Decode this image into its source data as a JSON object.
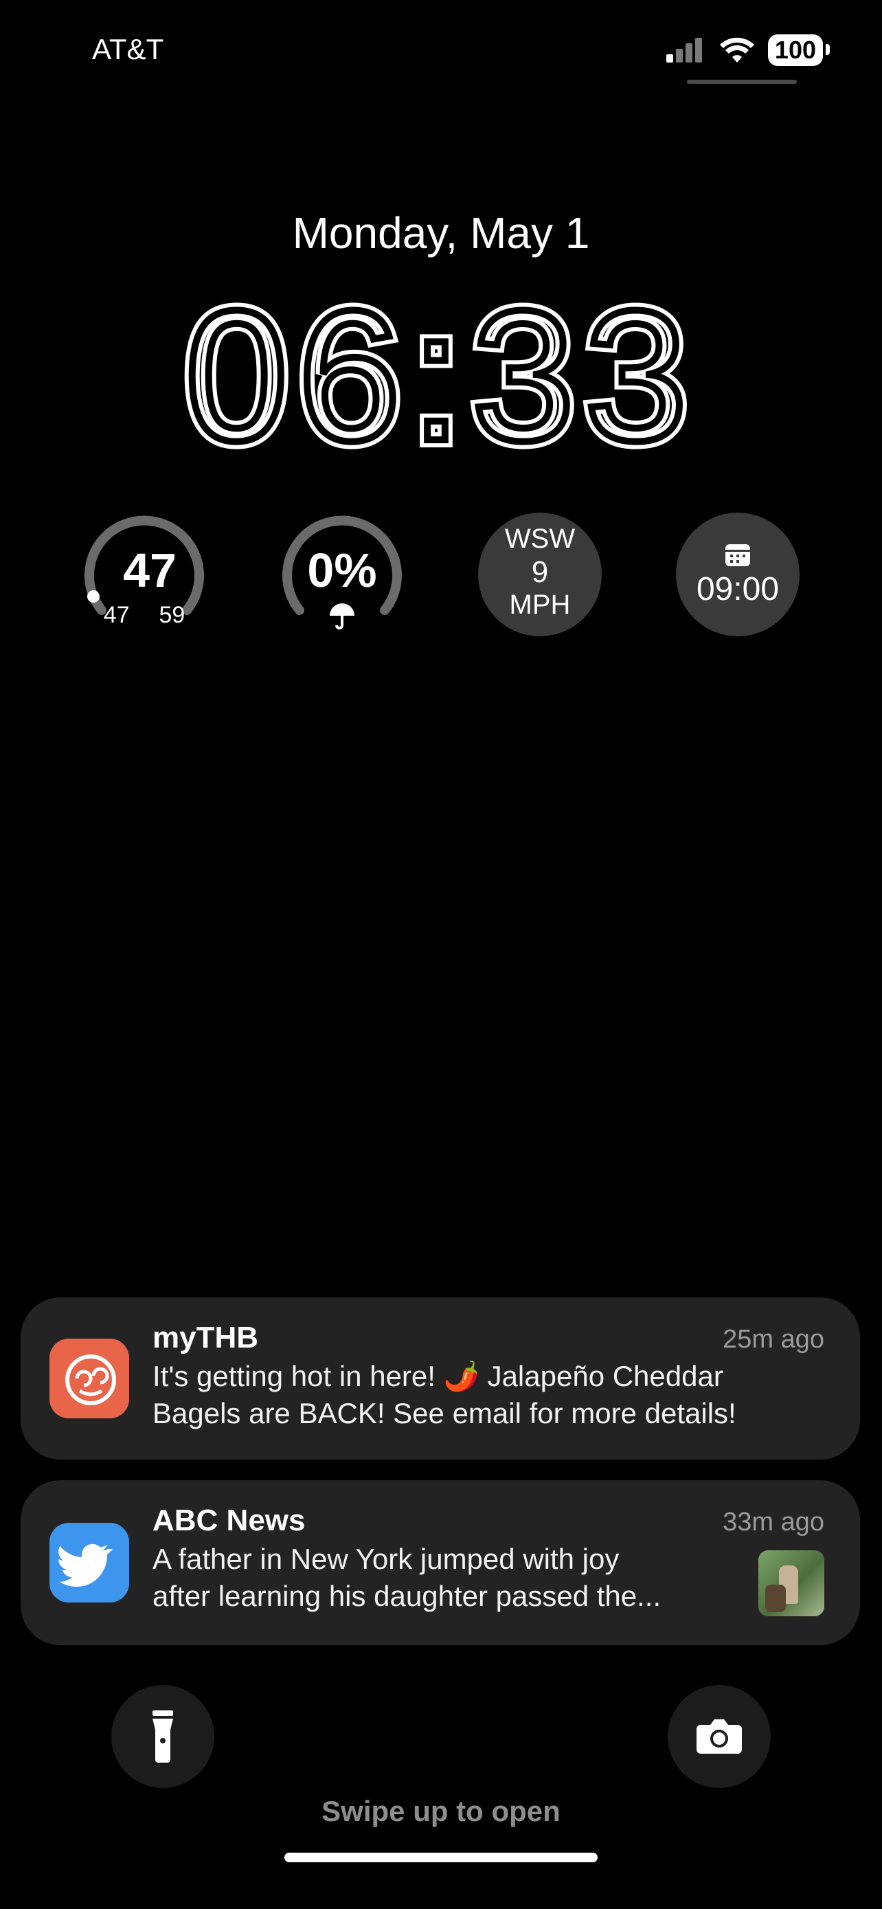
{
  "status": {
    "carrier": "AT&T",
    "battery": "100",
    "signal_icon": "cellular-signal-icon",
    "wifi_icon": "wifi-icon"
  },
  "lock": {
    "date": "Monday, May 1",
    "time": "06:33"
  },
  "widgets": {
    "temperature": {
      "current": "47",
      "low": "47",
      "high": "59"
    },
    "precip": {
      "value": "0%",
      "icon": "umbrella-icon"
    },
    "wind": {
      "dir": "WSW",
      "speed": "9",
      "unit": "MPH"
    },
    "alarm": {
      "time": "09:00",
      "icon": "calendar-icon"
    }
  },
  "notifications": [
    {
      "app": "myTHB",
      "time": "25m ago",
      "line1": "It's getting hot in here! 🌶️ Jalapeño Cheddar",
      "line2": "Bagels are BACK! See email for more details!",
      "icon_color": "#E8654A"
    },
    {
      "app": "ABC News",
      "time": "33m ago",
      "line1": "A father in New York jumped with joy",
      "line2": "after learning his daughter passed the...",
      "icon_color": "#3E95EE"
    }
  ],
  "actions": {
    "flashlight_icon": "flashlight-icon",
    "camera_icon": "camera-icon",
    "swipe_hint": "Swipe up to open"
  }
}
